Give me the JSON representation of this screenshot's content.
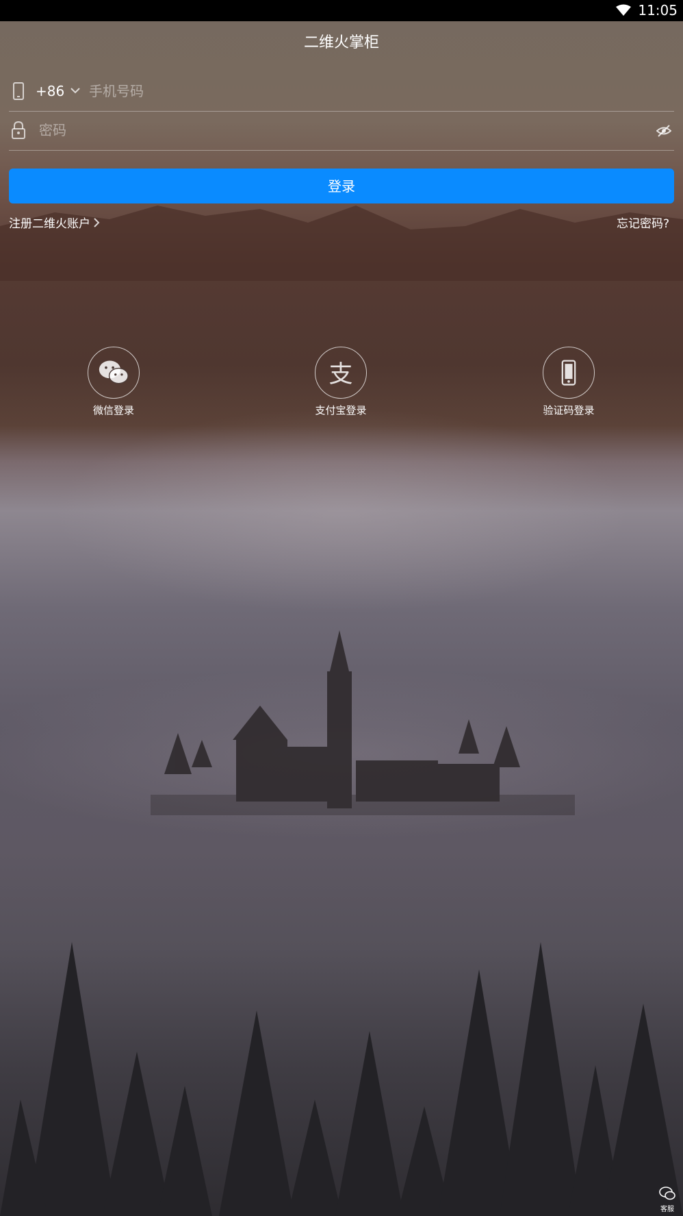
{
  "status_bar": {
    "time": "11:05"
  },
  "app_title": "二维火掌柜",
  "login_form": {
    "country_code": "+86",
    "phone_placeholder": "手机号码",
    "password_placeholder": "密码",
    "login_button": "登录",
    "register_link": "注册二维火账户",
    "forgot_link": "忘记密码?"
  },
  "alt_logins": [
    {
      "label": "微信登录",
      "icon": "wechat-icon"
    },
    {
      "label": "支付宝登录",
      "icon": "alipay-icon"
    },
    {
      "label": "验证码登录",
      "icon": "mobile-phone-icon"
    }
  ],
  "support": {
    "label": "客服"
  },
  "colors": {
    "accent": "#0a8bff"
  }
}
